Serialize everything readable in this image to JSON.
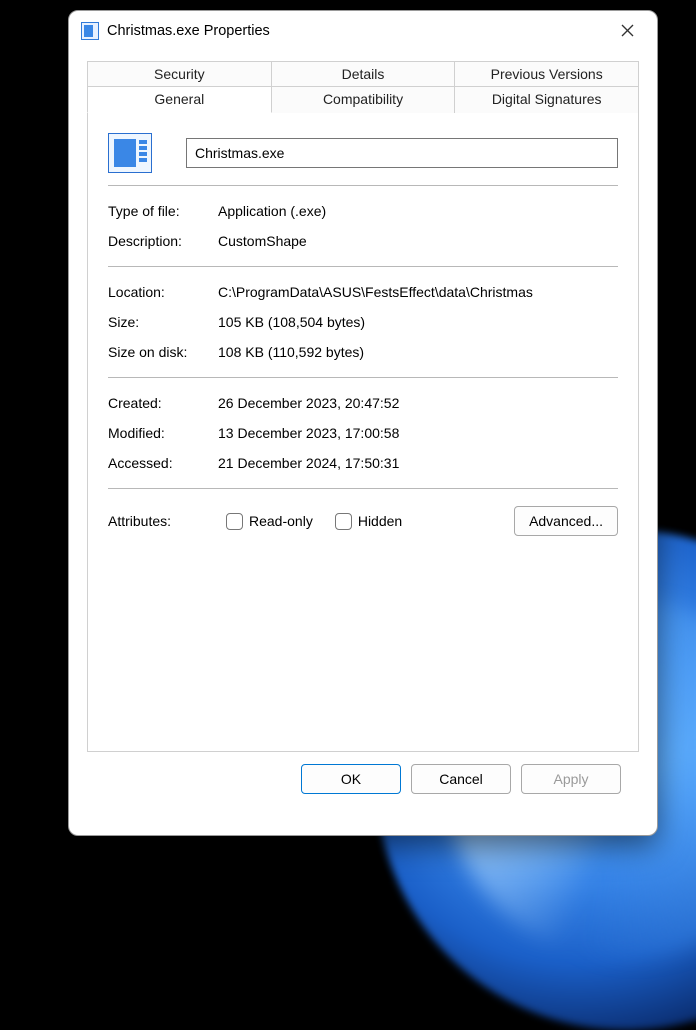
{
  "window": {
    "title": "Christmas.exe Properties"
  },
  "tabs": {
    "row1": [
      "Security",
      "Details",
      "Previous Versions"
    ],
    "row2": [
      "General",
      "Compatibility",
      "Digital Signatures"
    ],
    "active": "General"
  },
  "file": {
    "name": "Christmas.exe"
  },
  "props": {
    "typeLabel": "Type of file:",
    "typeValue": "Application (.exe)",
    "descLabel": "Description:",
    "descValue": "CustomShape",
    "locLabel": "Location:",
    "locValue": "C:\\ProgramData\\ASUS\\FestsEffect\\data\\Christmas",
    "sizeLabel": "Size:",
    "sizeValue": "105 KB (108,504 bytes)",
    "sizeDiskLabel": "Size on disk:",
    "sizeDiskValue": "108 KB (110,592 bytes)",
    "createdLabel": "Created:",
    "createdValue": "26 December 2023, 20:47:52",
    "modifiedLabel": "Modified:",
    "modifiedValue": "13 December 2023, 17:00:58",
    "accessedLabel": "Accessed:",
    "accessedValue": "21 December 2024, 17:50:31",
    "attrLabel": "Attributes:",
    "readonly": "Read-only",
    "hidden": "Hidden",
    "advanced": "Advanced..."
  },
  "buttons": {
    "ok": "OK",
    "cancel": "Cancel",
    "apply": "Apply"
  }
}
